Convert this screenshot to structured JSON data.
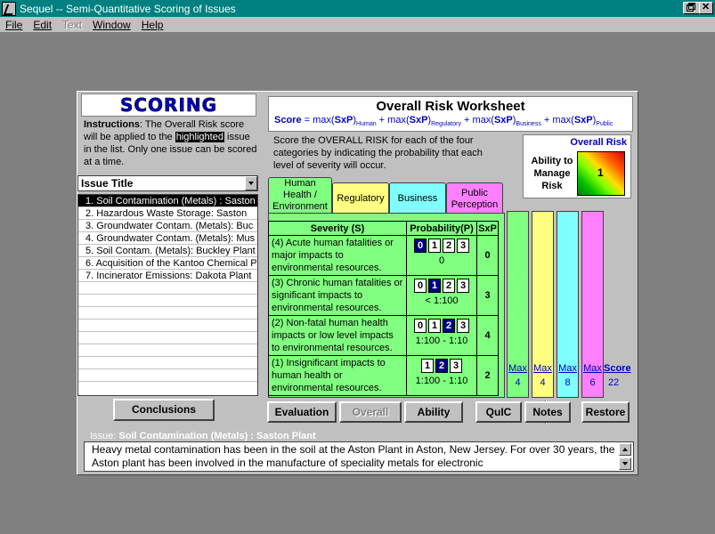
{
  "window": {
    "title": "Sequel -- Semi-Quantitative Scoring of Issues"
  },
  "menu": {
    "items": [
      {
        "label": "File",
        "enabled": true
      },
      {
        "label": "Edit",
        "enabled": true
      },
      {
        "label": "Text",
        "enabled": false
      },
      {
        "label": "Window",
        "enabled": true
      },
      {
        "label": "Help",
        "enabled": true
      }
    ]
  },
  "scoring": {
    "title": "SCORING",
    "instructions_bold": "Instructions",
    "instructions_pre": ":  The Overall Risk score will be applied to the ",
    "instructions_highlight": "highlighted",
    "instructions_post": " issue in the list.  Only one issue can be scored at a time."
  },
  "issues": {
    "header": "Issue Title",
    "items": [
      "1. Soil Contamination (Metals) : Saston",
      "2. Hazardous Waste Storage: Saston",
      "3. Groundwater Contam. (Metals): Buc",
      "4. Groundwater Contam. (Metals): Mus",
      "5. Soil Contam. (Metals): Buckley Plant",
      "6. Acquisition of the Kantoo Chemical P",
      "7. Incinerator Emissions: Dakota Plant"
    ],
    "selected_index": 0
  },
  "buttons": {
    "conclusions": "Conclusions",
    "evaluation": "Evaluation",
    "overall": "Overall",
    "ability": "Ability",
    "quic": "QuIC",
    "notes": "Notes",
    "restore": "Restore"
  },
  "worksheet": {
    "title": "Overall Risk Worksheet",
    "formula_label": "Score",
    "formula_parts": [
      {
        "text": "max(",
        "sub": ""
      },
      {
        "text": "SxP",
        "sub": "Human"
      },
      {
        "text": "max(",
        "sub": ""
      },
      {
        "text": "SxP",
        "sub": "Regulatory"
      },
      {
        "text": "max(",
        "sub": ""
      },
      {
        "text": "SxP",
        "sub": "Business"
      },
      {
        "text": "max(",
        "sub": ""
      },
      {
        "text": "SxP",
        "sub": "Public"
      }
    ],
    "description": "Score the OVERALL RISK for each of the four categories by indicating the probability that each level of severity will occur."
  },
  "overall_risk": {
    "label": "Overall Risk",
    "ability_label": "Ability to Manage Risk",
    "value": "1"
  },
  "tabs": [
    {
      "label": "Human Health / Environment",
      "color": "#80ff80"
    },
    {
      "label": "Regulatory",
      "color": "#ffff80"
    },
    {
      "label": "Business",
      "color": "#80ffff"
    },
    {
      "label": "Public Perception",
      "color": "#ff80ff"
    }
  ],
  "severity_table": {
    "headers": {
      "severity": "Severity (S)",
      "probability": "Probability(P)",
      "sxp": "SxP"
    },
    "rows": [
      {
        "text": "(4)  Acute human fatalities or major impacts to environmental resources.",
        "options": [
          "0",
          "1",
          "2",
          "3"
        ],
        "selected": "0",
        "prob_label": "0",
        "sxp": "0"
      },
      {
        "text": "(3)  Chronic human fatalities or significant impacts to environmental resources.",
        "options": [
          "0",
          "1",
          "2",
          "3"
        ],
        "selected": "1",
        "prob_label": "< 1:100",
        "sxp": "3"
      },
      {
        "text": "(2)  Non-fatal human health impacts or low level impacts to environmental resources.",
        "options": [
          "0",
          "1",
          "2",
          "3"
        ],
        "selected": "2",
        "prob_label": "1:100 - 1:10",
        "sxp": "4"
      },
      {
        "text": "(1)  Insignificant impacts to human health or environmental resources.",
        "options": [
          "1",
          "2",
          "3"
        ],
        "selected": "2",
        "prob_label": "1:100 - 1:10",
        "sxp": "2"
      }
    ]
  },
  "category_max": [
    {
      "label": "Max",
      "value": "4"
    },
    {
      "label": "Max",
      "value": "4"
    },
    {
      "label": "Max",
      "value": "8"
    },
    {
      "label": "Max",
      "value": "6"
    }
  ],
  "score": {
    "label": "Score",
    "value": "22"
  },
  "issue_detail": {
    "prefix": "Issue:",
    "title": "Soil Contamination (Metals) : Saston Plant",
    "description": "Heavy metal contamination has been in the soil at the Aston Plant in Aston, New Jersey.  For over 30 years, the Aston plant has been involved in the manufacture of speciality metals for electronic"
  }
}
